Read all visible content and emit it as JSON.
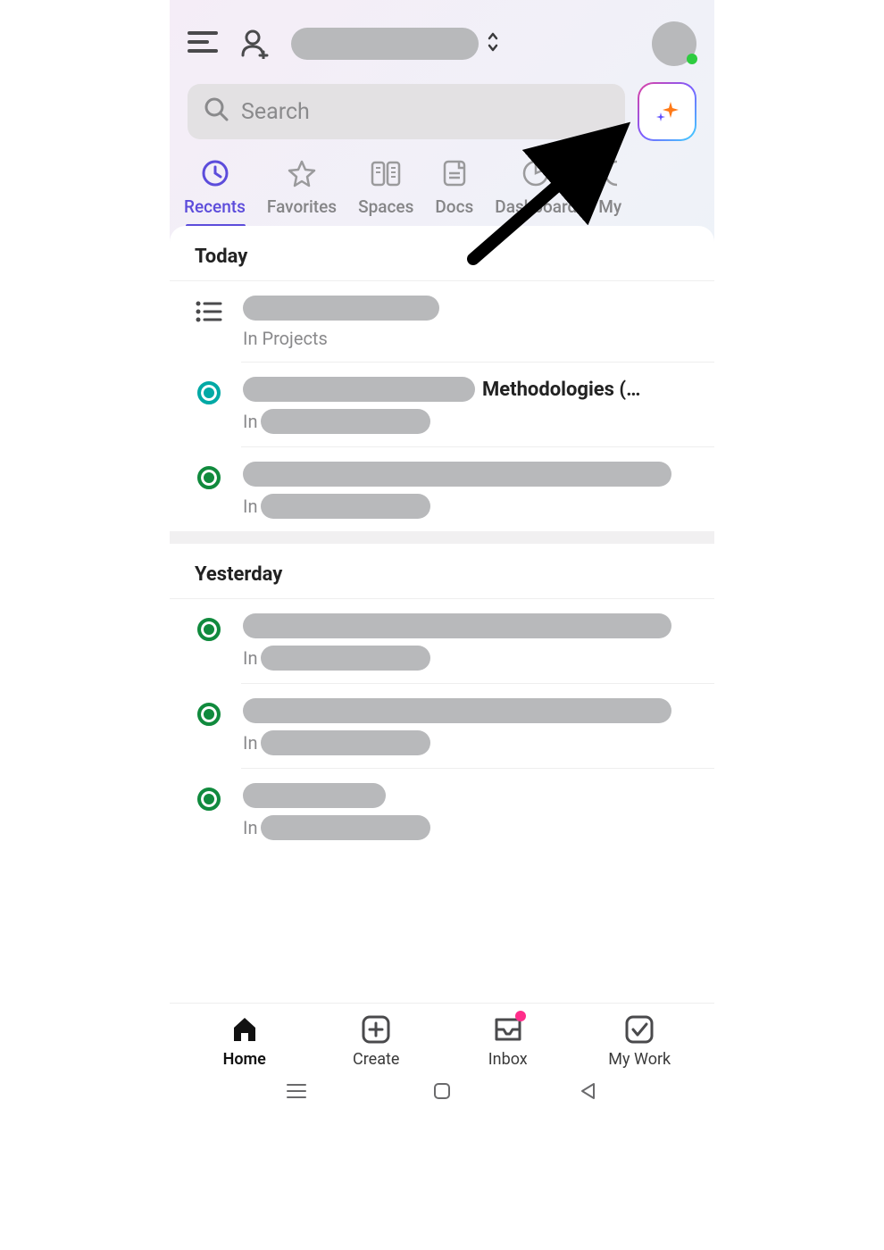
{
  "search": {
    "placeholder": "Search"
  },
  "tabs": [
    {
      "label": "Recents"
    },
    {
      "label": "Favorites"
    },
    {
      "label": "Spaces"
    },
    {
      "label": "Docs"
    },
    {
      "label": "Dashboard"
    },
    {
      "label": "My"
    }
  ],
  "sections": {
    "today": {
      "header": "Today",
      "item0_sub": "In Projects",
      "item1_title": "Methodologies (…",
      "item1_sub_prefix": "In",
      "item2_sub_prefix": "In"
    },
    "yesterday": {
      "header": "Yesterday",
      "item0_sub_prefix": "In",
      "item1_sub_prefix": "In",
      "item2_sub_prefix": "In"
    }
  },
  "bottom": [
    {
      "label": "Home"
    },
    {
      "label": "Create"
    },
    {
      "label": "Inbox"
    },
    {
      "label": "My Work"
    }
  ]
}
